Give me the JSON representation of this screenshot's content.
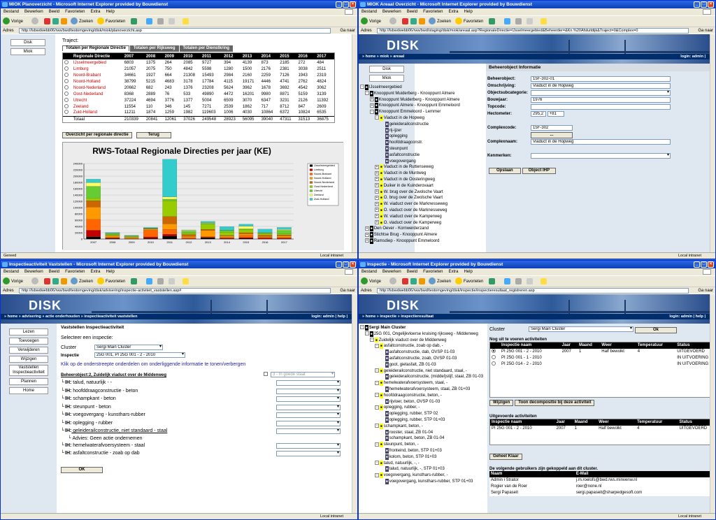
{
  "w1": {
    "title": "MIOK Planoverzicht - Microsoft Internet Explorer provided by Bouwdienst",
    "url": "http://lsbwdwebb06/rws/bwd/testomgeving/disk/miok/planoverzicht.asp",
    "nav": [
      "Disk",
      "Miok"
    ],
    "heading": "Traject:",
    "tabs": [
      "Totalen per Regionale Directie",
      "Totalen per Rijksweg",
      "Totalen per Dienstkring"
    ],
    "table": {
      "headers": [
        "Regionale Directie",
        "2007",
        "2008",
        "2009",
        "2010",
        "2011",
        "2012",
        "2013",
        "2014",
        "2015",
        "2016",
        "2017"
      ],
      "rows": [
        [
          "IJsselmeergebied",
          "6803",
          "1375",
          "264",
          "2085",
          "9727",
          "394",
          "4139",
          "873",
          "2185",
          "272",
          "484"
        ],
        [
          "Limburg",
          "21057",
          "2075",
          "750",
          "4842",
          "5598",
          "1280",
          "1500",
          "2176",
          "2381",
          "3038",
          "2511"
        ],
        [
          "Noord-Brabant",
          "34661",
          "1927",
          "664",
          "21308",
          "15493",
          "2984",
          "2160",
          "2259",
          "7126",
          "1943",
          "2319"
        ],
        [
          "Noord-Holland",
          "38799",
          "5215",
          "4683",
          "3178",
          "17784",
          "4115",
          "19171",
          "4446",
          "4741",
          "2762",
          "4824"
        ],
        [
          "Noord-Nederland",
          "20662",
          "682",
          "243",
          "1376",
          "23208",
          "5624",
          "3962",
          "1678",
          "3692",
          "4542",
          "3062"
        ],
        [
          "Oost-Nederland",
          "8368",
          "2889",
          "76",
          "533",
          "49890",
          "4472",
          "16201",
          "9980",
          "8871",
          "5159",
          "3139"
        ],
        [
          "Utrecht",
          "37224",
          "4694",
          "3776",
          "1377",
          "5004",
          "6509",
          "3070",
          "6347",
          "3231",
          "2126",
          "11392"
        ],
        [
          "Zeeland",
          "11554",
          "110",
          "346",
          "145",
          "7271",
          "2539",
          "1862",
          "717",
          "8712",
          "847",
          "2609"
        ],
        [
          "Zuid-Holland",
          "11211",
          "1874",
          "1259",
          "1982",
          "119603",
          "1006",
          "4030",
          "10864",
          "6372",
          "10824",
          "6535"
        ]
      ],
      "total": [
        "Totaal",
        "210339",
        "20841",
        "12061",
        "37026",
        "249548",
        "28923",
        "56095",
        "39040",
        "47311",
        "31513",
        "36875"
      ]
    },
    "buttons": [
      "Overzicht per regionale directie",
      "Terug"
    ],
    "status": "Gereed",
    "zone": "Local intranet"
  },
  "w2": {
    "title": "MIOK Areaal Overzicht - Microsoft Internet Explorer provided by Bouwdienst",
    "url": "http://lsbwdwebb06/rws/bwd/staging/disk/miok/areaal.asp?RegionaleDirectie=IJsselmeergebied&Beheerder=&Kn.%20Afsluitdijk&Traject=0&Complex=0",
    "logo": "DISK",
    "crumb": "» home » miok » areaal",
    "login": "login: admin |",
    "nav": [
      "Disk",
      "Miok"
    ],
    "tree": [
      {
        "t": "IJsselmeergebied",
        "l": 0,
        "i": "g",
        "o": "-"
      },
      {
        "t": "Knooppunt Muiderberg - Knooppunt Almere",
        "l": 1,
        "i": "bk",
        "o": "-"
      },
      {
        "t": "Knooppunt Muiderberg - Knooppunt Almere",
        "l": 2,
        "i": "bk",
        "o": "+"
      },
      {
        "t": "Knooppunt Almere - Knooppunt Emmeloord",
        "l": 2,
        "i": "bk",
        "o": "+"
      },
      {
        "t": "Knooppunt Emmeloord - Lemmer",
        "l": 2,
        "i": "bk",
        "o": "-"
      },
      {
        "t": "Viaduct in de Hopweg",
        "l": 3,
        "i": "y",
        "o": "-"
      },
      {
        "t": "geleiderailconstructie",
        "l": 4,
        "i": "gr",
        "o": ""
      },
      {
        "t": "rij-ijzer",
        "l": 4,
        "i": "gr",
        "o": ""
      },
      {
        "t": "oplegging",
        "l": 4,
        "i": "gr",
        "o": ""
      },
      {
        "t": "hoofddraagconstr.",
        "l": 4,
        "i": "gr",
        "o": ""
      },
      {
        "t": "steunpunt",
        "l": 4,
        "i": "gr",
        "o": ""
      },
      {
        "t": "asfaltconstructie",
        "l": 4,
        "i": "gr",
        "o": ""
      },
      {
        "t": "voegovergang",
        "l": 4,
        "i": "gr",
        "o": ""
      },
      {
        "t": "Viaduct in de Ruttenseweg",
        "l": 3,
        "i": "y",
        "o": "+"
      },
      {
        "t": "Viaduct in de Muntweg",
        "l": 3,
        "i": "y",
        "o": "+"
      },
      {
        "t": "Viaduct in de Oosteringweg",
        "l": 3,
        "i": "y",
        "o": "+"
      },
      {
        "t": "Duiker in de Kuinderovaart",
        "l": 3,
        "i": "y",
        "o": "+"
      },
      {
        "t": "W. brug over de Zwolsche Vaart",
        "l": 3,
        "i": "y",
        "o": "+"
      },
      {
        "t": "O. brug over de Zwolsche Vaart",
        "l": 3,
        "i": "y",
        "o": "+"
      },
      {
        "t": "W. viaduct over de Marknesseweg",
        "l": 3,
        "i": "y",
        "o": "+"
      },
      {
        "t": "O. viaduct over de Marknesseweg",
        "l": 3,
        "i": "y",
        "o": "+"
      },
      {
        "t": "W. viaduct over de Kamperweg",
        "l": 3,
        "i": "y",
        "o": "+"
      },
      {
        "t": "O. viaduct over de Kamperweg",
        "l": 3,
        "i": "y",
        "o": "+"
      },
      {
        "t": "Den Oever - Kornwerderzand",
        "l": 1,
        "i": "bk",
        "o": "+"
      },
      {
        "t": "Stichtse Brug - Knooppunt Almere",
        "l": 1,
        "i": "bk",
        "o": "+"
      },
      {
        "t": "Ramsdiep - Knooppunt Emmeloord",
        "l": 1,
        "i": "bk",
        "o": "+"
      }
    ],
    "form": {
      "header": "Beheerobject Informatie",
      "labels": [
        "Beheerobject:",
        "Omschrijving:",
        "Objectsubcategorie:",
        "Bouwjaar:",
        "Topcode:",
        "Hectometer:",
        "Complexcode:",
        "Complexnaam:",
        "Kenmerken:"
      ],
      "values": [
        "15F-302-01",
        "Viaduct in de Hopweg",
        "",
        "1976",
        "",
        "295,2",
        "15F-302",
        "Viaduct in de Hopweg",
        ""
      ],
      "hm2": "+81",
      "dots": "...",
      "buttons": [
        "Opslaan",
        "Object IHP"
      ]
    },
    "zone": "Local intranet"
  },
  "w3": {
    "title": "Inspectieactiviteit Vaststellen - Microsoft Internet Explorer provided by Bouwdienst",
    "url": "http://lsbwdwebb06/rws/bwd/testomgeving/disk/advisering/inspectie-activiteit_vaststellen.asp#",
    "logo": "DISK",
    "crumb": "» home » advisering » actie onderhouden » inspectieactiviteit vaststellen",
    "login": "login: admin | help |",
    "nav": [
      "Lezen",
      "Toevoegen",
      "Verwijderen",
      "Wijzigen",
      "Vaststellen Inspectieactiviteit",
      "Plannen",
      "Home"
    ],
    "title2": "Vaststellen Inspectieactiviteit",
    "intro": "Selecteer een inspectie:",
    "cluster_label": "Cluster",
    "cluster": "Sergi Main Cluster",
    "insp_label": "Inspectie",
    "insp": "25G 001, PI 25G 001 - 2 - 2010",
    "hint": "Klik op de onderstreepte onderdelen om onderliggende informatie te tonen/verbergen",
    "object": "Beheerobject:2, Zuidelijk viaduct over de Middenweg",
    "state": "3 - In goede staat",
    "items": [
      {
        "t": "talud, natuurlijk - -",
        "i": "IH:"
      },
      {
        "t": "hoofddraagconstructie - beton",
        "i": "IH:"
      },
      {
        "t": "schampkant - beton",
        "i": "IH:"
      },
      {
        "t": "steunpunt - beton",
        "i": "IH:"
      },
      {
        "t": "voegovergang - kunsthars-rubber",
        "i": "IH:"
      },
      {
        "t": "oplegging - rubber",
        "i": "IH:"
      },
      {
        "t": "geleiderailconstructie, niet standaard - staal",
        "i": "IH:"
      },
      {
        "t": "hemelwaterafvoersysteem - staal",
        "i": "IH:"
      },
      {
        "t": "asfaltconstructie - zoab op dab",
        "i": "IH:"
      }
    ],
    "advies": "Advies: Geen actie ondernemen",
    "ok": "OK",
    "zone": "Local intranet"
  },
  "w4": {
    "title": "Inspectie - Microsoft Internet Explorer provided by Bouwdienst",
    "url": "http://lsbwdwebb06/rws/bwd/testomgeving/disk/inspectie/inspectieresultaat_registreren.asp",
    "logo": "DISK",
    "crumb": "» home » inspectie » inspectieresultaat",
    "login": "login: admin | help |",
    "tree": [
      {
        "t": "Sergi Main Cluster",
        "l": 0,
        "i": "bk",
        "o": "-",
        "b": true
      },
      {
        "t": "25G 001, Ongelijkvloerse kruising rijksweg - Middenweg",
        "l": 1,
        "i": "bk",
        "o": "-"
      },
      {
        "t": "Zuidelijk viaduct over de Middenweg",
        "l": 2,
        "i": "y",
        "o": "-"
      },
      {
        "t": "asfaltconstructie, zoab op dab, -",
        "l": 3,
        "i": "y",
        "o": "-"
      },
      {
        "t": "asfaltconstructie, dab, OVSP 01-03",
        "l": 4,
        "i": "gr",
        "o": ""
      },
      {
        "t": "asfaltconstructie, zoab, OVSP 01-03",
        "l": 4,
        "i": "gr",
        "o": ""
      },
      {
        "t": "goot, gietasfalt, ZB 01-03",
        "l": 4,
        "i": "gr",
        "o": ""
      },
      {
        "t": "geleiderailconstructie, niet standaard, staal, -",
        "l": 3,
        "i": "y",
        "o": "-"
      },
      {
        "t": "geleiderailconstructie, (middel)stijf, staal, ZB 01-03",
        "l": 4,
        "i": "gr",
        "o": ""
      },
      {
        "t": "hemelwaterafvoersysteem, staal, -",
        "l": 3,
        "i": "y",
        "o": "-"
      },
      {
        "t": "hemelwaterafvoersysteem, staal, ZB 01+03",
        "l": 4,
        "i": "gr",
        "o": ""
      },
      {
        "t": "hoofddraagconstructie, beton, -",
        "l": 3,
        "i": "y",
        "o": "-"
      },
      {
        "t": "rijvloer, beton, OVSP 01-03",
        "l": 4,
        "i": "gr",
        "o": ""
      },
      {
        "t": "oplegging, rubber, -",
        "l": 3,
        "i": "y",
        "o": "-"
      },
      {
        "t": "oplegging, rubber, STP 02",
        "l": 4,
        "i": "gr",
        "o": ""
      },
      {
        "t": "oplegging, rubber, STP 01+03",
        "l": 4,
        "i": "gr",
        "o": ""
      },
      {
        "t": "schampkant, beton, -",
        "l": 3,
        "i": "y",
        "o": "-"
      },
      {
        "t": "rooster, staal, ZB 01-04",
        "l": 4,
        "i": "gr",
        "o": ""
      },
      {
        "t": "schampkant, beton, ZB 01-04",
        "l": 4,
        "i": "gr",
        "o": ""
      },
      {
        "t": "steunpunt, beton, -",
        "l": 3,
        "i": "y",
        "o": "-"
      },
      {
        "t": "fronteind, beton, STP 01+03",
        "l": 4,
        "i": "gr",
        "o": ""
      },
      {
        "t": "kolom, beton, STP 01+03",
        "l": 4,
        "i": "gr",
        "o": ""
      },
      {
        "t": "talud, natuurlijk, -, -",
        "l": 3,
        "i": "y",
        "o": "-"
      },
      {
        "t": "talud, natuurlijk, -, STP 01+03",
        "l": 4,
        "i": "gr",
        "o": ""
      },
      {
        "t": "voegovergang, kunsthars-rubber, -",
        "l": 3,
        "i": "y",
        "o": "-"
      },
      {
        "t": "voegovergang, kunsthars-rubber, STP 01+03",
        "l": 4,
        "i": "gr",
        "o": ""
      }
    ],
    "cluster_label": "Cluster",
    "cluster": "Sergi Main Cluster",
    "ok": "Ok",
    "todo_title": "Nog uit te voeren activiteiten",
    "act_headers": [
      "Inspectie naam",
      "Jaar",
      "Maand",
      "Weer",
      "Temperatuur",
      "Status"
    ],
    "todo": [
      [
        "PI 25G 001 - 2 - 2010",
        "2007",
        "1",
        "Half bewolkt",
        "4",
        "UITGEVOERD"
      ],
      [
        "PI 25G 001 - 1 - 2010",
        "",
        "",
        "",
        "",
        "IN UITVOERING"
      ],
      [
        "PI 25G 014 - 2 - 2010",
        "",
        "",
        "",
        "",
        "IN UITVOERING"
      ]
    ],
    "btns": [
      "Wijzigen",
      "Toon decompositie bij deze activiteit"
    ],
    "done_title": "Uitgevoerde activiteiten",
    "done": [
      [
        "PI 25G 001 - 2 - 2010",
        "2007",
        "1",
        "Half bewolkt",
        "4",
        "UITGEVOERD"
      ]
    ],
    "klaar": "Geheel Klaar",
    "users_title": "De volgende gebruikers zijn gekoppeld aan dit cluster.",
    "user_headers": [
      "Naam",
      "E-Mail"
    ],
    "users": [
      [
        "Admin i Strator",
        "j.m.roelofs@bwd.rws.minvenw.nl"
      ],
      [
        "Rogier van de Roer",
        "roer@none.nl"
      ],
      [
        "Sergi Papaseit",
        "sergi.papaseit@sharpedgesoft.com"
      ]
    ],
    "zone": "Local intranet"
  },
  "common": {
    "menu": [
      "Bestand",
      "Bewerken",
      "Beeld",
      "Favorieten",
      "Extra",
      "Help"
    ],
    "back": "Vorige",
    "search": "Zoeken",
    "fav": "Favorieten",
    "addr": "Adres",
    "go": "Ga naar"
  },
  "chart_data": {
    "type": "bar",
    "title": "RWS-Totaal Regionale Directies per jaar (KE)",
    "categories": [
      "2007",
      "2008",
      "2009",
      "2010",
      "2011",
      "2012",
      "2013",
      "2014",
      "2015",
      "2016",
      "2017"
    ],
    "ylim": [
      0,
      240000
    ],
    "yticks": [
      "0",
      "20000",
      "40000",
      "60000",
      "80000",
      "100000",
      "120000",
      "140000",
      "160000",
      "180000",
      "200000",
      "220000",
      "240000"
    ],
    "series": [
      {
        "name": "IJsselmeergebied",
        "color": "#000000",
        "values": [
          6803,
          1375,
          264,
          2085,
          9727,
          394,
          4139,
          873,
          2185,
          272,
          484
        ]
      },
      {
        "name": "Limburg",
        "color": "#c00000",
        "values": [
          21057,
          2075,
          750,
          4842,
          5598,
          1280,
          1500,
          2176,
          2381,
          3038,
          2511
        ]
      },
      {
        "name": "Noord-Brabant",
        "color": "#ff6600",
        "values": [
          34661,
          1927,
          664,
          21308,
          15493,
          2984,
          2160,
          2259,
          7126,
          1943,
          2319
        ]
      },
      {
        "name": "Noord-Holland",
        "color": "#ff9900",
        "values": [
          38799,
          5215,
          4683,
          3178,
          17784,
          4115,
          19171,
          4446,
          4741,
          2762,
          4824
        ]
      },
      {
        "name": "Noord-Nederland",
        "color": "#cc6600",
        "values": [
          20662,
          682,
          243,
          1376,
          23208,
          5624,
          3962,
          1678,
          3692,
          4542,
          3062
        ]
      },
      {
        "name": "Oost-Nederland",
        "color": "#99cc00",
        "values": [
          8368,
          2889,
          76,
          533,
          49890,
          4472,
          16201,
          9980,
          8871,
          5159,
          3139
        ]
      },
      {
        "name": "Utrecht",
        "color": "#66cc33",
        "values": [
          37224,
          4694,
          3776,
          1377,
          5004,
          6509,
          3070,
          6347,
          3231,
          2126,
          11392
        ]
      },
      {
        "name": "Zeeland",
        "color": "#ffff66",
        "values": [
          11554,
          110,
          346,
          145,
          7271,
          2539,
          1862,
          717,
          8712,
          847,
          2609
        ]
      },
      {
        "name": "Zuid-Holland",
        "color": "#33cccc",
        "values": [
          11211,
          1874,
          1259,
          1982,
          119603,
          1006,
          4030,
          10864,
          6372,
          10824,
          6535
        ]
      }
    ]
  }
}
